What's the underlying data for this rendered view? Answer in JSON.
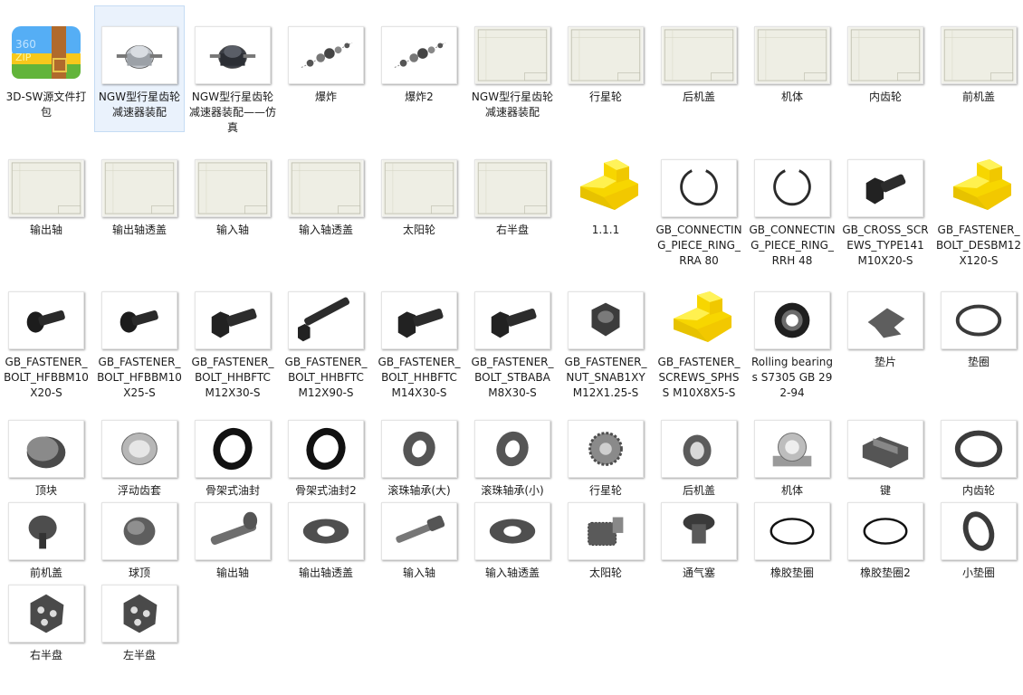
{
  "files": [
    {
      "name": "3D-SW源文件打包",
      "icon": "archive-360zip-icon",
      "selected": false
    },
    {
      "name": "NGW型行星齿轮减速器装配",
      "icon": "assembly-thumbnail-icon",
      "selected": true
    },
    {
      "name": "NGW型行星齿轮减速器装配——仿真",
      "icon": "assembly-dark-thumbnail-icon",
      "selected": false
    },
    {
      "name": "爆炸",
      "icon": "exploded-view-thumbnail-icon",
      "selected": false
    },
    {
      "name": "爆炸2",
      "icon": "exploded-view-thumbnail-icon",
      "selected": false
    },
    {
      "name": "NGW型行星齿轮减速器装配",
      "icon": "drawing-sheet-icon",
      "selected": false
    },
    {
      "name": "行星轮",
      "icon": "drawing-sheet-icon",
      "selected": false
    },
    {
      "name": "后机盖",
      "icon": "drawing-sheet-icon",
      "selected": false
    },
    {
      "name": "机体",
      "icon": "drawing-sheet-icon",
      "selected": false
    },
    {
      "name": "内齿轮",
      "icon": "drawing-sheet-icon",
      "selected": false
    },
    {
      "name": "前机盖",
      "icon": "drawing-sheet-icon",
      "selected": false
    },
    {
      "name": "输出轴",
      "icon": "drawing-sheet-icon",
      "selected": false
    },
    {
      "name": "输出轴透盖",
      "icon": "drawing-sheet-icon",
      "selected": false
    },
    {
      "name": "输入轴",
      "icon": "drawing-sheet-icon",
      "selected": false
    },
    {
      "name": "输入轴透盖",
      "icon": "drawing-sheet-icon",
      "selected": false
    },
    {
      "name": "太阳轮",
      "icon": "drawing-sheet-icon",
      "selected": false
    },
    {
      "name": "右半盘",
      "icon": "drawing-sheet-icon",
      "selected": false
    },
    {
      "name": "1.1.1",
      "icon": "yellow-part-icon",
      "selected": false
    },
    {
      "name": "GB_CONNECTING_PIECE_RING_RRA 80",
      "icon": "retaining-ring-icon",
      "selected": false
    },
    {
      "name": "GB_CONNECTING_PIECE_RING_RRH 48",
      "icon": "retaining-ring-icon",
      "selected": false
    },
    {
      "name": "GB_CROSS_SCREWS_TYPE141 M10X20-S",
      "icon": "hex-screw-icon",
      "selected": false
    },
    {
      "name": "GB_FASTENER_BOLT_DESBM12X120-S",
      "icon": "yellow-part-icon",
      "selected": false
    },
    {
      "name": "GB_FASTENER_BOLT_HFBBM10X20-S",
      "icon": "flange-bolt-icon",
      "selected": false
    },
    {
      "name": "GB_FASTENER_BOLT_HFBBM10X25-S",
      "icon": "flange-bolt-icon",
      "selected": false
    },
    {
      "name": "GB_FASTENER_BOLT_HHBFTC M12X30-S",
      "icon": "hex-bolt-icon",
      "selected": false
    },
    {
      "name": "GB_FASTENER_BOLT_HHBFTC M12X90-S",
      "icon": "long-bolt-icon",
      "selected": false
    },
    {
      "name": "GB_FASTENER_BOLT_HHBFTC M14X30-S",
      "icon": "hex-bolt-icon",
      "selected": false
    },
    {
      "name": "GB_FASTENER_BOLT_STBABA M8X30-S",
      "icon": "hex-bolt-icon",
      "selected": false
    },
    {
      "name": "GB_FASTENER_NUT_SNAB1XY M12X1.25-S",
      "icon": "hex-nut-icon",
      "selected": false
    },
    {
      "name": "GB_FASTENER_SCREWS_SPHSS M10X8X5-S",
      "icon": "yellow-part-icon",
      "selected": false
    },
    {
      "name": "Rolling bearings S7305 GB 292-94",
      "icon": "bearing-icon",
      "selected": false
    },
    {
      "name": "垫片",
      "icon": "shim-icon",
      "selected": false
    },
    {
      "name": "垫圈",
      "icon": "washer-ring-icon",
      "selected": false
    },
    {
      "name": "顶块",
      "icon": "disc-block-icon",
      "selected": false
    },
    {
      "name": "浮动齿套",
      "icon": "gear-sleeve-icon",
      "selected": false
    },
    {
      "name": "骨架式油封",
      "icon": "oil-seal-icon",
      "selected": false
    },
    {
      "name": "骨架式油封2",
      "icon": "oil-seal-icon",
      "selected": false
    },
    {
      "name": "滚珠轴承(大)",
      "icon": "ball-bearing-icon",
      "selected": false
    },
    {
      "name": "滚珠轴承(小)",
      "icon": "ball-bearing-icon",
      "selected": false
    },
    {
      "name": "行星轮",
      "icon": "planet-gear-icon",
      "selected": false
    },
    {
      "name": "后机盖",
      "icon": "rear-cover-icon",
      "selected": false
    },
    {
      "name": "机体",
      "icon": "housing-icon",
      "selected": false
    },
    {
      "name": "键",
      "icon": "key-icon",
      "selected": false
    },
    {
      "name": "内齿轮",
      "icon": "ring-gear-icon",
      "selected": false
    },
    {
      "name": "前机盖",
      "icon": "front-cover-icon",
      "selected": false
    },
    {
      "name": "球顶",
      "icon": "dome-cap-icon",
      "selected": false
    },
    {
      "name": "输出轴",
      "icon": "output-shaft-icon",
      "selected": false
    },
    {
      "name": "输出轴透盖",
      "icon": "flange-cover-icon",
      "selected": false
    },
    {
      "name": "输入轴",
      "icon": "input-shaft-icon",
      "selected": false
    },
    {
      "name": "输入轴透盖",
      "icon": "flange-cover-icon",
      "selected": false
    },
    {
      "name": "太阳轮",
      "icon": "sun-gear-icon",
      "selected": false
    },
    {
      "name": "通气塞",
      "icon": "vent-plug-icon",
      "selected": false
    },
    {
      "name": "橡胶垫圈",
      "icon": "rubber-ring-icon",
      "selected": false
    },
    {
      "name": "橡胶垫圈2",
      "icon": "rubber-ring-icon",
      "selected": false
    },
    {
      "name": "小垫圈",
      "icon": "small-washer-icon",
      "selected": false
    },
    {
      "name": "右半盘",
      "icon": "half-disc-icon",
      "selected": false
    },
    {
      "name": "左半盘",
      "icon": "half-disc-icon",
      "selected": false
    }
  ]
}
